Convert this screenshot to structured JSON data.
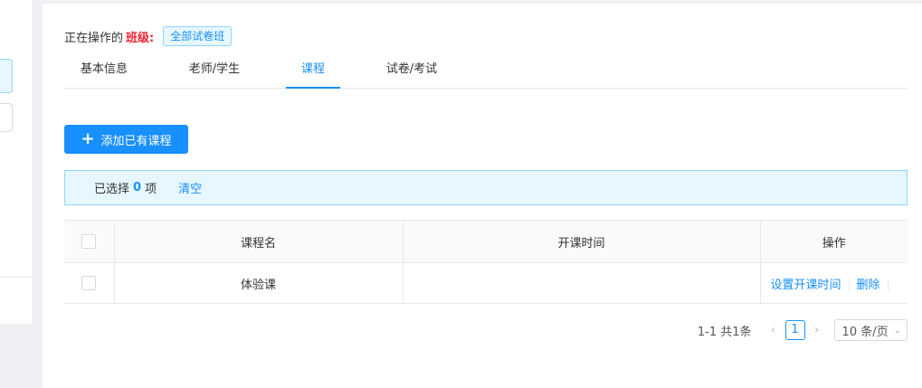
{
  "operating": {
    "prefix": "正在操作的",
    "label": "班级:",
    "class_name": "全部试卷班"
  },
  "tabs": [
    {
      "label": "基本信息"
    },
    {
      "label": "老师/学生"
    },
    {
      "label": "课程"
    },
    {
      "label": "试卷/考试"
    }
  ],
  "active_tab": "课程",
  "add_button": {
    "icon": "plus-icon",
    "label": "添加已有课程"
  },
  "selection": {
    "prefix": "已选择",
    "count": "0",
    "suffix": "项",
    "clear_label": "清空"
  },
  "table": {
    "columns": [
      "课程名",
      "开课时间",
      "操作"
    ],
    "rows": [
      {
        "name": "体验课",
        "start_time": "",
        "actions": [
          "设置开课时间",
          "删除"
        ]
      }
    ]
  },
  "pagination": {
    "total_text": "1-1 共1条",
    "current_page": "1",
    "page_size": "10 条/页"
  },
  "colors": {
    "primary": "#1890ff",
    "highlight": "#f5222d",
    "alert_bg": "#e6f7ff"
  }
}
